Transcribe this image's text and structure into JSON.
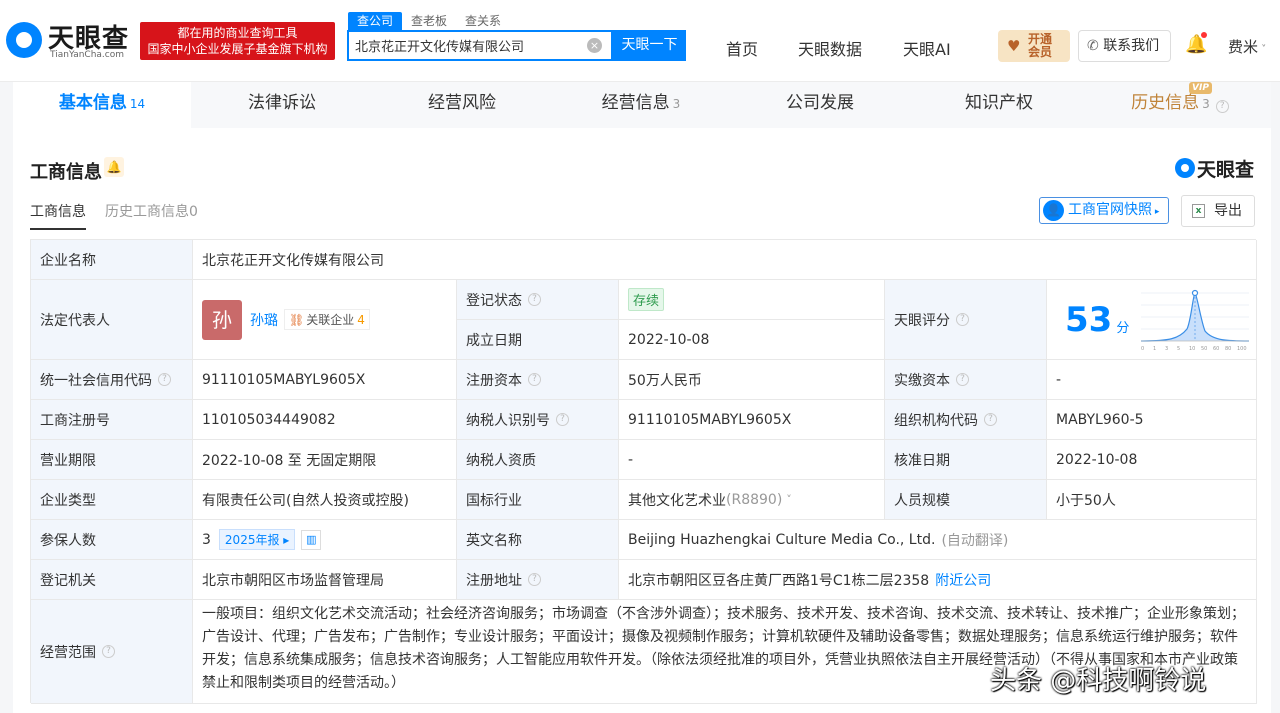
{
  "header": {
    "logo_text": "天眼查",
    "logo_sub": "TianYanCha.com",
    "banner_line1": "都在用的商业查询工具",
    "banner_line2": "国家中小企业发展子基金旗下机构",
    "search_tabs": [
      "查公司",
      "查老板",
      "查关系"
    ],
    "search_value": "北京花正开文化传媒有限公司",
    "search_clear": "×",
    "search_button": "天眼一下",
    "nav": [
      "首页",
      "天眼数据",
      "天眼AI"
    ],
    "vip_line1": "开通",
    "vip_line2": "会员",
    "contact": "联系我们",
    "user": "费米"
  },
  "tabs": [
    {
      "label": "基本信息",
      "count": "14"
    },
    {
      "label": "法律诉讼",
      "count": ""
    },
    {
      "label": "经营风险",
      "count": ""
    },
    {
      "label": "经营信息",
      "count": "3"
    },
    {
      "label": "公司发展",
      "count": ""
    },
    {
      "label": "知识产权",
      "count": ""
    },
    {
      "label": "历史信息",
      "count": "3"
    }
  ],
  "vip_badge": "VIP",
  "section": {
    "title": "工商信息",
    "brand": "天眼查",
    "subtab_current": "工商信息",
    "subtab_history": "历史工商信息0",
    "snapshot_button": "工商官网快照",
    "export_button": "导出"
  },
  "info": {
    "company_name_label": "企业名称",
    "company_name": "北京花正开文化传媒有限公司",
    "legal_rep_label": "法定代表人",
    "legal_rep_avatar": "孙",
    "legal_rep_name": "孙璐",
    "related_label": "关联企业",
    "related_count": "4",
    "reg_status_label": "登记状态",
    "reg_status": "存续",
    "found_date_label": "成立日期",
    "found_date": "2022-10-08",
    "score_label": "天眼评分",
    "score": "53",
    "score_unit": "分",
    "score_axis": [
      "0",
      "1",
      "3",
      "5",
      "10",
      "50",
      "60",
      "80",
      "100"
    ],
    "credit_code_label": "统一社会信用代码",
    "credit_code": "91110105MABYL9605X",
    "reg_capital_label": "注册资本",
    "reg_capital": "50万人民币",
    "paid_capital_label": "实缴资本",
    "paid_capital": "-",
    "reg_no_label": "工商注册号",
    "reg_no": "110105034449082",
    "tax_id_label": "纳税人识别号",
    "tax_id": "91110105MABYL9605X",
    "org_code_label": "组织机构代码",
    "org_code": "MABYL960-5",
    "term_label": "营业期限",
    "term": "2022-10-08 至 无固定期限",
    "tax_qual_label": "纳税人资质",
    "tax_qual": "-",
    "approve_date_label": "核准日期",
    "approve_date": "2022-10-08",
    "type_label": "企业类型",
    "type": "有限责任公司(自然人投资或控股)",
    "industry_label": "国标行业",
    "industry": "其他文化艺术业",
    "industry_code": "(R8890)",
    "staff_label": "人员规模",
    "staff": "小于50人",
    "insured_label": "参保人数",
    "insured": "3",
    "report_year": "2025年报",
    "english_label": "英文名称",
    "english": "Beijing Huazhengkai Culture Media Co., Ltd.",
    "english_note": "(自动翻译)",
    "authority_label": "登记机关",
    "authority": "北京市朝阳区市场监督管理局",
    "address_label": "注册地址",
    "address": "北京市朝阳区豆各庄黄厂西路1号C1栋二层2358",
    "nearby": "附近公司",
    "scope_label": "经营范围",
    "scope": "一般项目：组织文化艺术交流活动；社会经济咨询服务；市场调查（不含涉外调查）；技术服务、技术开发、技术咨询、技术交流、技术转让、技术推广；企业形象策划；广告设计、代理；广告发布；广告制作；专业设计服务；平面设计；摄像及视频制作服务；计算机软硬件及辅助设备零售；数据处理服务；信息系统运行维护服务；软件开发；信息系统集成服务；信息技术咨询服务；人工智能应用软件开发。（除依法须经批准的项目外，凭营业执照依法自主开展经营活动）（不得从事国家和本市产业政策禁止和限制类项目的经营活动。）"
  },
  "watermark": "头条 @科技啊铃说"
}
